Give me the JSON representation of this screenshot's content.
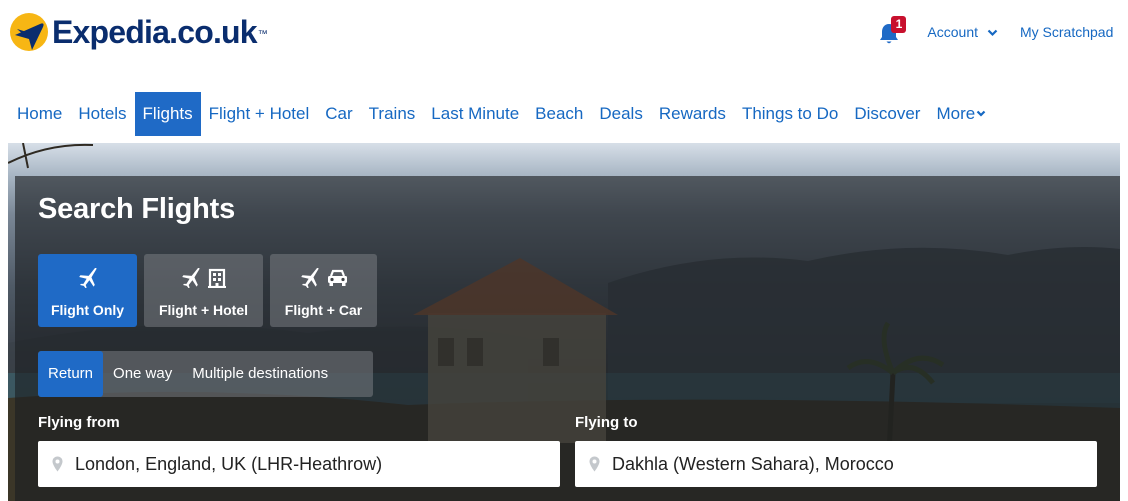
{
  "header": {
    "logo_text": "Expedia.co.uk",
    "logo_tm": "™",
    "notification_count": "1",
    "account_label": "Account",
    "scratchpad_label": "My Scratchpad"
  },
  "nav": {
    "items": [
      {
        "label": "Home"
      },
      {
        "label": "Hotels"
      },
      {
        "label": "Flights",
        "active": true
      },
      {
        "label": "Flight + Hotel"
      },
      {
        "label": "Car"
      },
      {
        "label": "Trains"
      },
      {
        "label": "Last Minute"
      },
      {
        "label": "Beach"
      },
      {
        "label": "Deals"
      },
      {
        "label": "Rewards"
      },
      {
        "label": "Things to Do"
      },
      {
        "label": "Discover"
      },
      {
        "label": "More"
      }
    ]
  },
  "search": {
    "title": "Search Flights",
    "products": [
      {
        "label": "Flight Only",
        "icons": [
          "plane-icon"
        ],
        "active": true
      },
      {
        "label": "Flight + Hotel",
        "icons": [
          "plane-icon",
          "hotel-icon"
        ]
      },
      {
        "label": "Flight + Car",
        "icons": [
          "plane-icon",
          "car-icon"
        ]
      }
    ],
    "trip_types": [
      {
        "label": "Return",
        "active": true
      },
      {
        "label": "One way"
      },
      {
        "label": "Multiple destinations"
      }
    ],
    "from": {
      "label": "Flying from",
      "value": "London, England, UK (LHR-Heathrow)"
    },
    "to": {
      "label": "Flying to",
      "value": "Dakhla (Western Sahara), Morocco"
    }
  },
  "colors": {
    "brand_blue": "#1f6ac6",
    "link_blue": "#1668c2",
    "logo_navy": "#0a2d6e",
    "logo_yellow": "#f7b614",
    "badge_red": "#c8102e"
  }
}
